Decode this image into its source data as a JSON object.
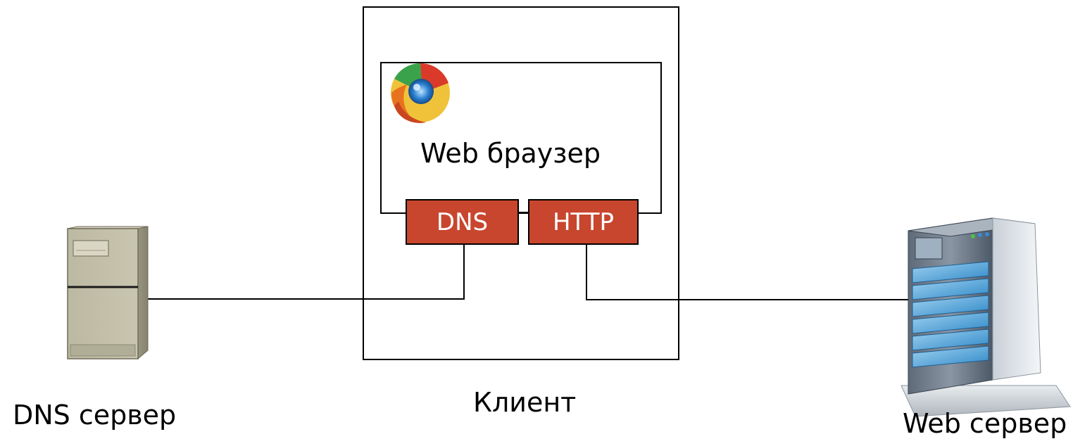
{
  "diagram": {
    "client": {
      "label": "Клиент",
      "browser": {
        "label": "Web браузер",
        "icon": "browser-logo-icon",
        "protocols": [
          {
            "label": "DNS"
          },
          {
            "label": "HTTP"
          }
        ]
      }
    },
    "dns_server": {
      "label": "DNS сервер",
      "icon": "dns-server-tower-icon"
    },
    "web_server": {
      "label": "Web сервер",
      "icon": "web-server-rack-icon"
    },
    "colors": {
      "protocol_box": "#c8462e",
      "protocol_text": "#ffffff",
      "lines": "#000000"
    }
  }
}
